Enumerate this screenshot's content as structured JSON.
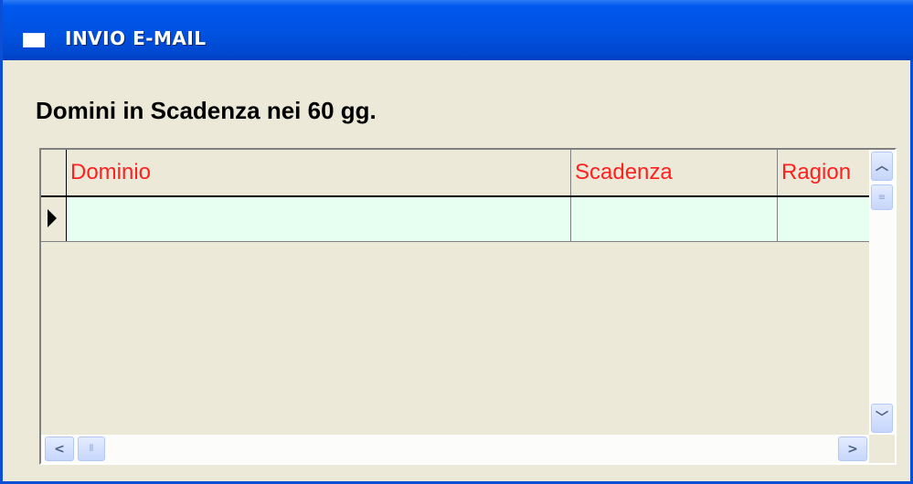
{
  "window": {
    "title": "INVIO E-MAIL",
    "icon": "window-icon"
  },
  "heading": "Domini in Scadenza nei 60 gg.",
  "grid": {
    "columns": [
      {
        "label": "Dominio"
      },
      {
        "label": "Scadenza"
      },
      {
        "label": "Ragion"
      }
    ],
    "rows": [
      {
        "current": true,
        "cells": [
          "",
          "",
          ""
        ]
      }
    ],
    "header_text_color": "#ff2020",
    "row_background": "#e6fff0"
  },
  "scrollbars": {
    "up_icon": "chevron-up-icon",
    "down_icon": "chevron-down-icon",
    "left_icon": "chevron-left-icon",
    "right_icon": "chevron-right-icon"
  },
  "colors": {
    "titlebar": "#0052e0",
    "window_bg": "#ece9d8"
  }
}
